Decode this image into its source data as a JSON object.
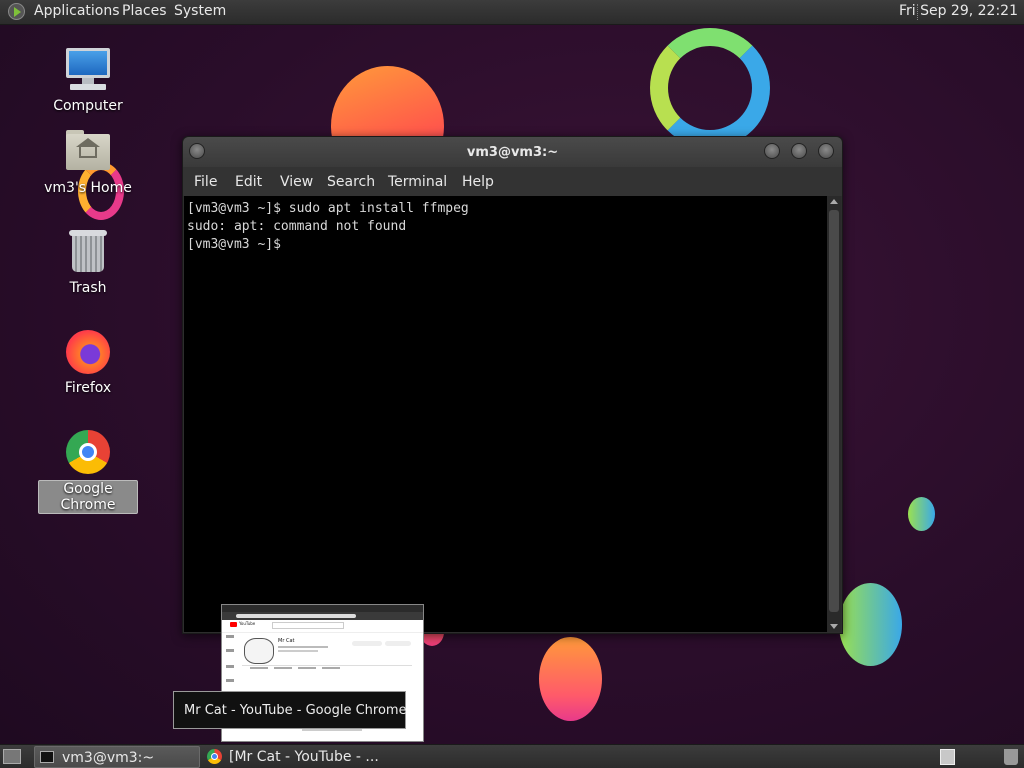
{
  "top_panel": {
    "applications": "Applications",
    "places": "Places",
    "system": "System",
    "clock": "Fri Sep 29, 22:21"
  },
  "desktop_icons": [
    {
      "label": "Computer",
      "icon": "computer-icon"
    },
    {
      "label": "vm3's Home",
      "icon": "home-folder-icon"
    },
    {
      "label": "Trash",
      "icon": "trash-icon"
    },
    {
      "label": "Firefox",
      "icon": "firefox-icon"
    },
    {
      "label": "Google Chrome",
      "icon": "chrome-icon",
      "selected": true
    }
  ],
  "terminal": {
    "title": "vm3@vm3:~",
    "menu": [
      "File",
      "Edit",
      "View",
      "Search",
      "Terminal",
      "Help"
    ],
    "lines": [
      "[vm3@vm3 ~]$ sudo apt install ffmpeg",
      "sudo: apt: command not found",
      "[vm3@vm3 ~]$ "
    ]
  },
  "chrome_thumbnail": {
    "site": "YouTube",
    "channel": "Mr Cat"
  },
  "tooltip": "Mr Cat - YouTube - Google Chrome",
  "taskbar": {
    "tasks": [
      {
        "label": "vm3@vm3:~",
        "icon": "terminal-icon",
        "active": true
      },
      {
        "label": "[Mr Cat - YouTube - ...",
        "icon": "chrome-icon",
        "active": false
      }
    ]
  },
  "colors": {
    "desktop_bg": "#2a0d2a",
    "panel_bg": "#333333",
    "terminal_bg": "#000000",
    "terminal_fg": "#d8d8d8"
  }
}
